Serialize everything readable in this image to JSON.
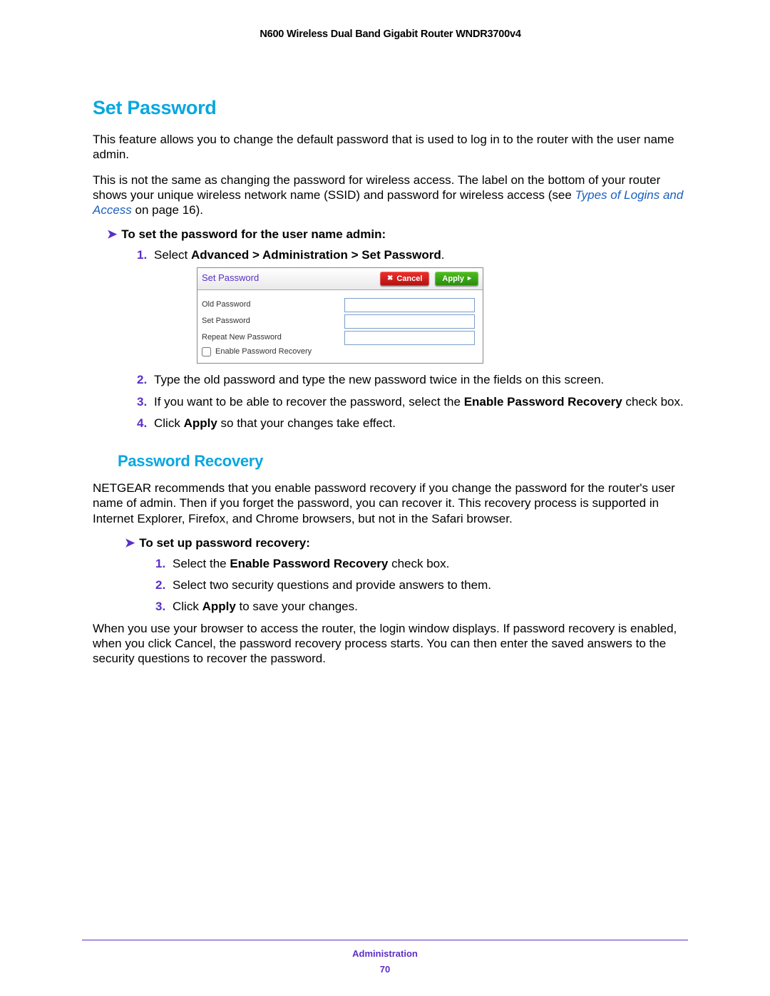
{
  "header": {
    "product": "N600 Wireless Dual Band Gigabit Router WNDR3700v4"
  },
  "section1": {
    "title": "Set Password",
    "p1": "This feature allows you to change the default password that is used to log in to the router with the user name admin.",
    "p2a": "This is not the same as changing the password for wireless access. The label on the bottom of your router shows your unique wireless network name (SSID) and password for wireless access (see ",
    "p2_link": "Types of Logins and Access",
    "p2b": " on page 16).",
    "task_head": "To set the password for the user name admin:",
    "steps": {
      "s1a": "Select ",
      "s1b": "Advanced > Administration > Set Password",
      "s1c": ".",
      "s2": "Type the old password and type the new password twice in the fields on this screen.",
      "s3a": "If you want to be able to recover the password, select the ",
      "s3b": "Enable Password Recovery",
      "s3c": " check box.",
      "s4a": "Click ",
      "s4b": "Apply",
      "s4c": " so that your changes take effect."
    }
  },
  "ui": {
    "title": "Set Password",
    "cancel": "Cancel",
    "apply": "Apply",
    "rows": {
      "old": "Old Password",
      "new": "Set Password",
      "repeat": "Repeat New Password",
      "enable": "Enable Password Recovery"
    }
  },
  "section2": {
    "title": "Password Recovery",
    "p1": "NETGEAR recommends that you enable password recovery if you change the password for the router's user name of admin. Then if you forget the password, you can recover it. This recovery process is supported in Internet Explorer, Firefox, and Chrome browsers, but not in the Safari browser.",
    "task_head": "To set up password recovery:",
    "steps": {
      "s1a": "Select the ",
      "s1b": "Enable Password Recovery",
      "s1c": " check box.",
      "s2": "Select two security questions and provide answers to them.",
      "s3a": "Click ",
      "s3b": "Apply",
      "s3c": " to save your changes."
    },
    "p2": "When you use your browser to access the router, the login window displays. If password recovery is enabled, when you click Cancel, the password recovery process starts. You can then enter the saved answers to the security questions to recover the password."
  },
  "footer": {
    "section": "Administration",
    "page": "70"
  }
}
